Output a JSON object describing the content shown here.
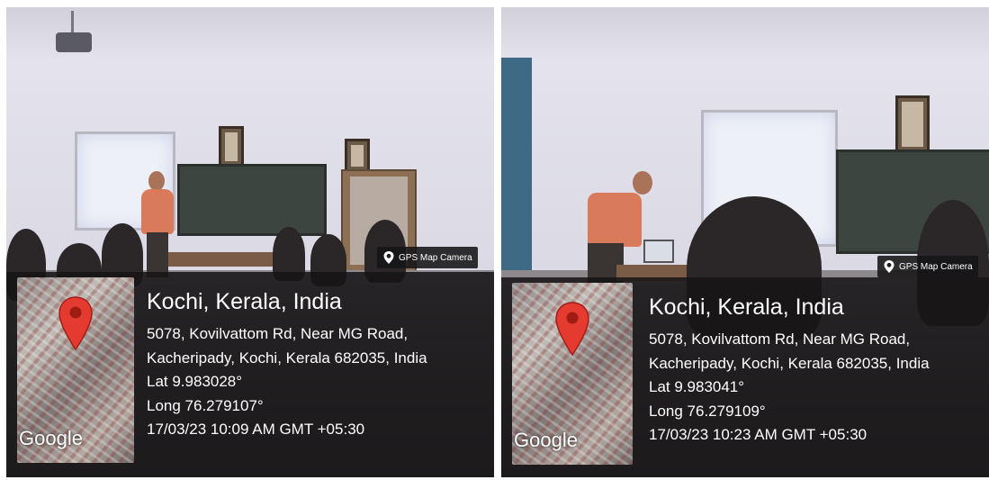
{
  "photos": [
    {
      "brand": "GPS Map Camera",
      "map_logo": "Google",
      "pin_icon": "location-pin-icon",
      "pin_color": "#e53a2f",
      "title": "Kochi, Kerala, India",
      "address_line1": "5078, Kovilvattom Rd, Near MG Road,",
      "address_line2": "Kacheripady, Kochi, Kerala 682035, India",
      "lat": "Lat 9.983028°",
      "long": "Long 76.279107°",
      "datetime": "17/03/23 10:09 AM GMT +05:30"
    },
    {
      "brand": "GPS Map Camera",
      "map_logo": "Google",
      "pin_icon": "location-pin-icon",
      "pin_color": "#e53a2f",
      "title": "Kochi, Kerala, India",
      "address_line1": "5078, Kovilvattom Rd, Near MG Road,",
      "address_line2": "Kacheripady, Kochi, Kerala 682035, India",
      "lat": "Lat 9.983041°",
      "long": "Long 76.279109°",
      "datetime": "17/03/23 10:23 AM GMT +05:30"
    }
  ]
}
